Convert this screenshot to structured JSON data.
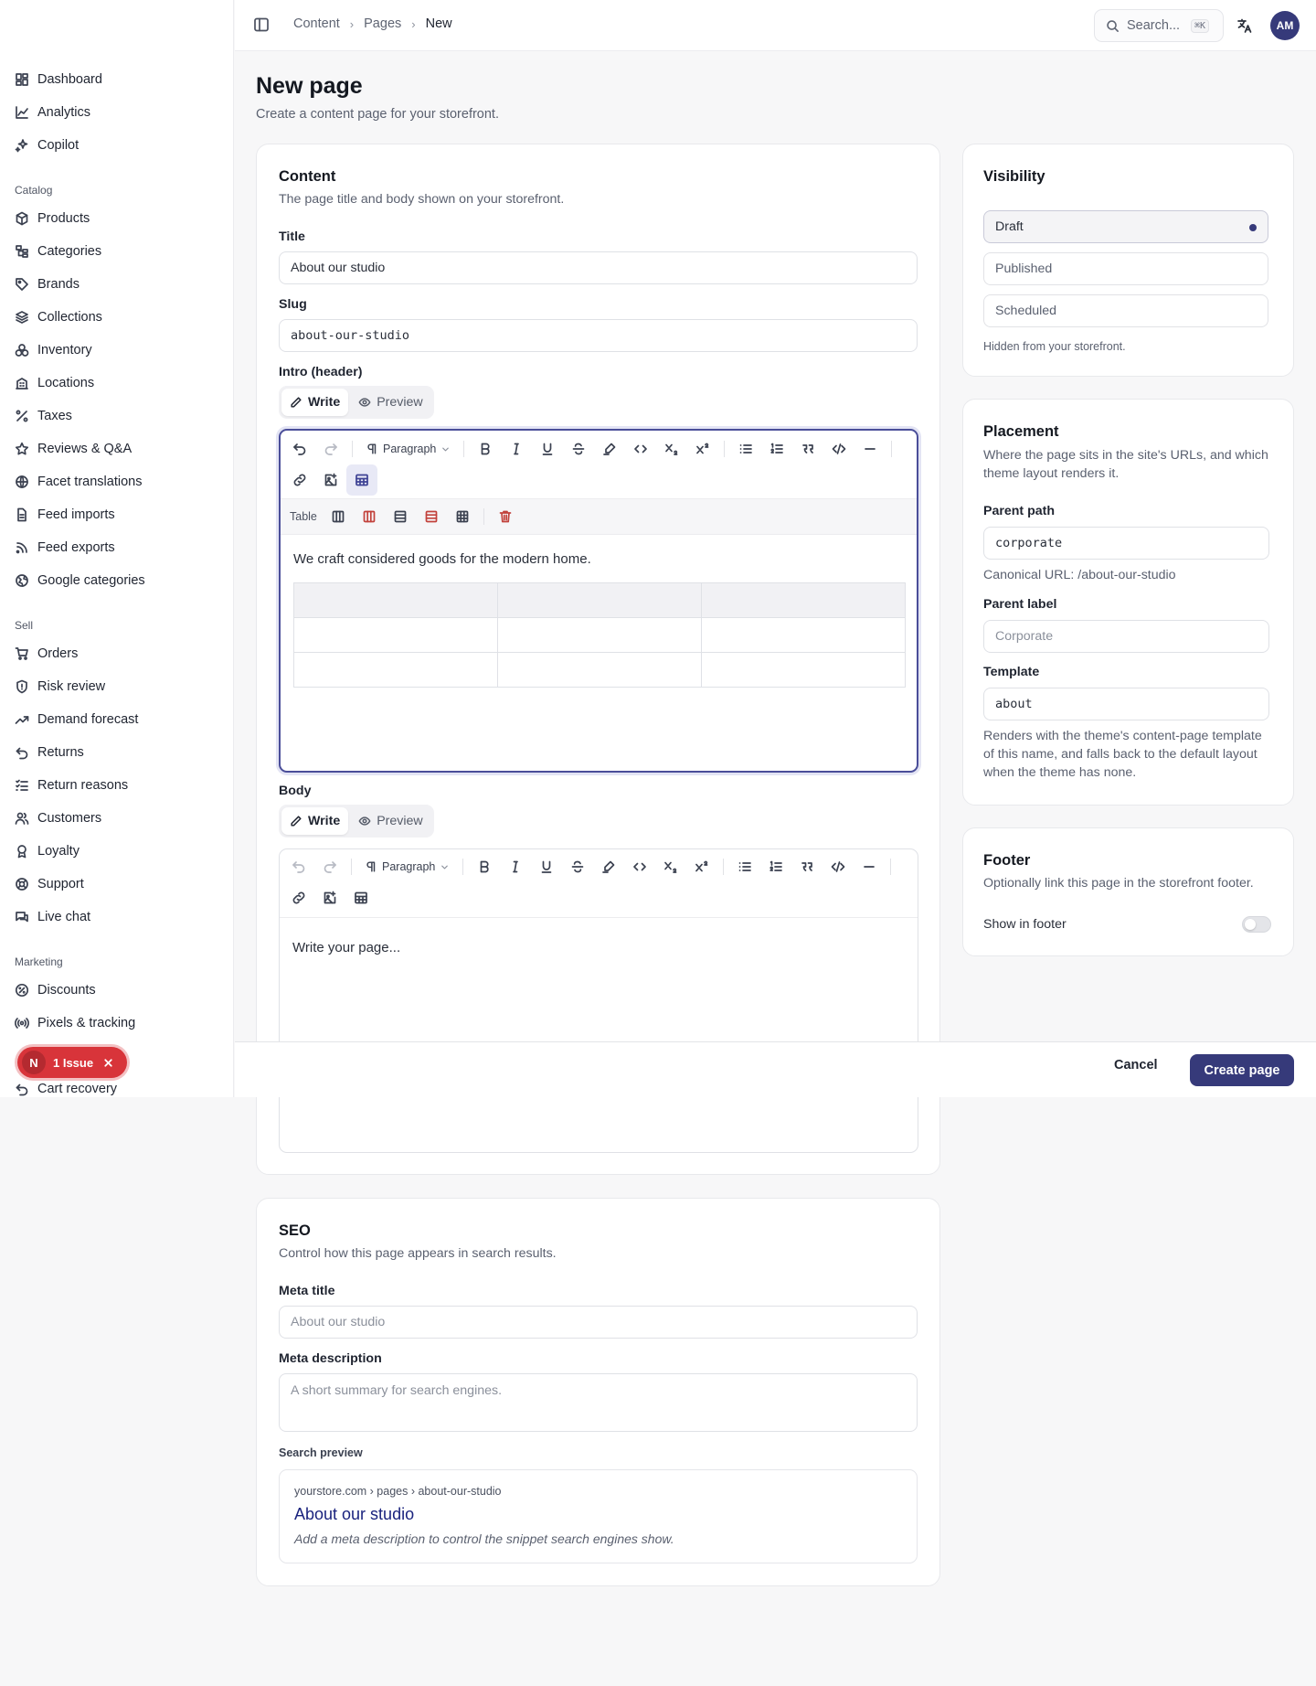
{
  "sidebar": {
    "top": [
      {
        "label": "Dashboard",
        "icon": "dashboard-icon"
      },
      {
        "label": "Analytics",
        "icon": "analytics-icon"
      },
      {
        "label": "Copilot",
        "icon": "sparkles-icon"
      }
    ],
    "catalog_heading": "Catalog",
    "catalog": [
      {
        "label": "Products",
        "icon": "package-icon"
      },
      {
        "label": "Categories",
        "icon": "hierarchy-icon"
      },
      {
        "label": "Brands",
        "icon": "tag-icon"
      },
      {
        "label": "Collections",
        "icon": "layers-icon"
      },
      {
        "label": "Inventory",
        "icon": "boxes-icon"
      },
      {
        "label": "Locations",
        "icon": "building-icon"
      },
      {
        "label": "Taxes",
        "icon": "percent-icon"
      },
      {
        "label": "Reviews & Q&A",
        "icon": "star-icon"
      },
      {
        "label": "Facet translations",
        "icon": "translate-icon"
      },
      {
        "label": "Feed imports",
        "icon": "file-import-icon"
      },
      {
        "label": "Feed exports",
        "icon": "rss-icon"
      },
      {
        "label": "Google categories",
        "icon": "globe-icon"
      }
    ],
    "sell_heading": "Sell",
    "sell": [
      {
        "label": "Orders",
        "icon": "cart-icon"
      },
      {
        "label": "Risk review",
        "icon": "shield-icon"
      },
      {
        "label": "Demand forecast",
        "icon": "trend-icon"
      },
      {
        "label": "Returns",
        "icon": "return-icon"
      },
      {
        "label": "Return reasons",
        "icon": "checklist-icon"
      },
      {
        "label": "Customers",
        "icon": "users-icon"
      },
      {
        "label": "Loyalty",
        "icon": "award-icon"
      },
      {
        "label": "Support",
        "icon": "lifebuoy-icon"
      },
      {
        "label": "Live chat",
        "icon": "chat-icon"
      }
    ],
    "marketing_heading": "Marketing",
    "marketing": [
      {
        "label": "Discounts",
        "icon": "discount-icon"
      },
      {
        "label": "Pixels & tracking",
        "icon": "broadcast-icon"
      },
      {
        "label": "Cart recovery",
        "icon": "return-icon"
      }
    ]
  },
  "topbar": {
    "breadcrumbs": [
      "Content",
      "Pages",
      "New"
    ],
    "search_label": "Search...",
    "search_shortcut": "⌘K",
    "avatar": "AM"
  },
  "page": {
    "title": "New page",
    "subtitle": "Create a content page for your storefront."
  },
  "content_card": {
    "title": "Content",
    "subtitle": "The page title and body shown on your storefront.",
    "title_label": "Title",
    "title_value": "About our studio",
    "slug_label": "Slug",
    "slug_value": "about-our-studio",
    "intro_label": "Intro (header)",
    "body_label": "Body",
    "write_tab": "Write",
    "preview_tab": "Preview",
    "paragraph_label": "Paragraph",
    "table_label": "Table",
    "intro_text": "We craft considered goods for the modern home.",
    "body_placeholder": "Write your page..."
  },
  "visibility": {
    "title": "Visibility",
    "options": [
      "Draft",
      "Published",
      "Scheduled"
    ],
    "selected": "Draft",
    "note": "Hidden from your storefront."
  },
  "placement": {
    "title": "Placement",
    "subtitle": "Where the page sits in the site's URLs, and which theme layout renders it.",
    "parent_path_label": "Parent path",
    "parent_path_value": "corporate",
    "canonical": "Canonical URL: /about-our-studio",
    "parent_label_label": "Parent label",
    "parent_label_placeholder": "Corporate",
    "template_label": "Template",
    "template_value": "about",
    "template_help": "Renders with the theme's content-page template of this name, and falls back to the default layout when the theme has none."
  },
  "footer_card": {
    "title": "Footer",
    "subtitle": "Optionally link this page in the storefront footer.",
    "toggle_label": "Show in footer",
    "toggle_on": false
  },
  "seo": {
    "title": "SEO",
    "subtitle": "Control how this page appears in search results.",
    "meta_title_label": "Meta title",
    "meta_title_placeholder": "About our studio",
    "meta_desc_label": "Meta description",
    "meta_desc_placeholder": "A short summary for search engines.",
    "preview_label": "Search preview",
    "preview_url": "yourstore.com › pages › about-our-studio",
    "preview_title": "About our studio",
    "preview_desc": "Add a meta description to control the snippet search engines show."
  },
  "actions": {
    "cancel": "Cancel",
    "create": "Create page"
  },
  "issue_badge": {
    "letter": "N",
    "label": "1 Issue"
  },
  "colors": {
    "accent": "#363a7a",
    "danger": "#d8343a",
    "link": "#1a0dab"
  }
}
